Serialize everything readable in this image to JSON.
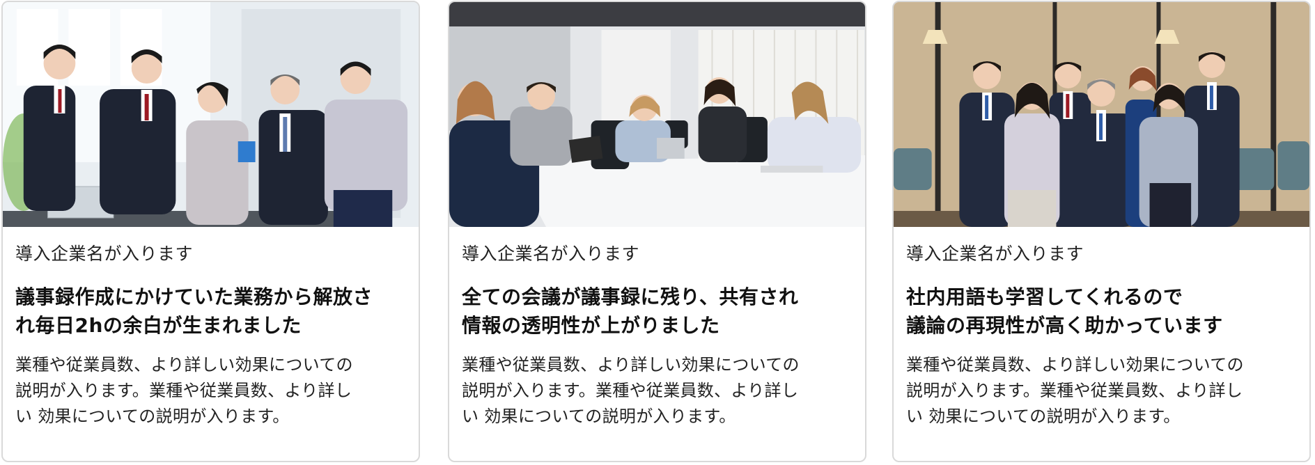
{
  "cards": [
    {
      "photo": "team-standing-office-photo",
      "company": "導入企業名が入ります",
      "headline": [
        "議事録作成にかけていた業務から解放さ",
        "れ毎日2hの余白が生まれました"
      ],
      "description": [
        "業種や従業員数、より詳しい効果についての",
        "説明が入ります。業種や従業員数、より詳し",
        "い 効果についての説明が入ります。"
      ]
    },
    {
      "photo": "meeting-table-photo",
      "company": "導入企業名が入ります",
      "headline": [
        "全ての会議が議事録に残り、共有され",
        "情報の透明性が上がりました"
      ],
      "description": [
        "業種や従業員数、より詳しい効果についての",
        "説明が入ります。業種や従業員数、より詳し",
        "い 効果についての説明が入ります。"
      ]
    },
    {
      "photo": "group-portrait-photo",
      "company": "導入企業名が入ります",
      "headline": [
        "社内用語も学習してくれるので",
        "議論の再現性が高く助かっています"
      ],
      "description": [
        "業種や従業員数、より詳しい効果についての",
        "説明が入ります。業種や従業員数、より詳し",
        "い 効果についての説明が入ります。"
      ]
    }
  ]
}
